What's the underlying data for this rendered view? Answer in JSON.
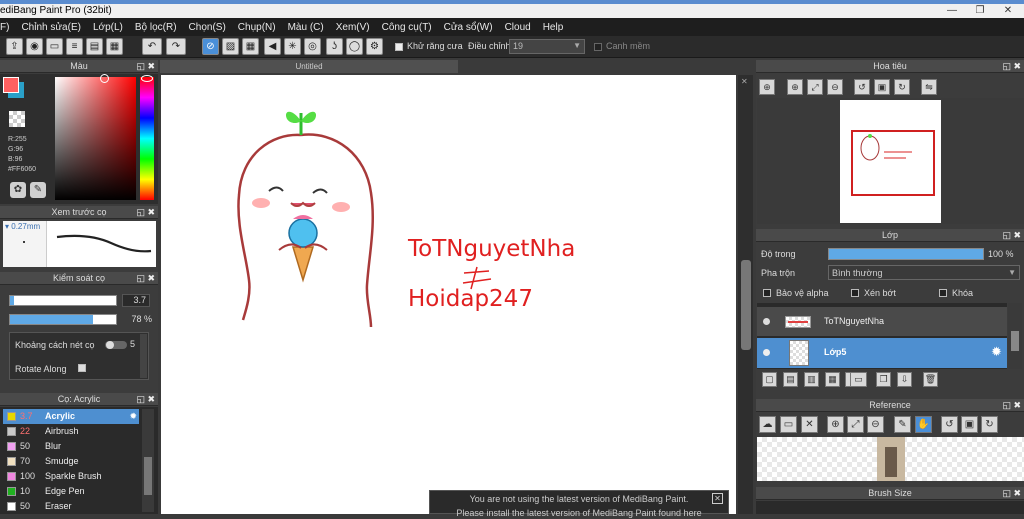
{
  "window": {
    "title": "ediBang Paint Pro (32bit)"
  },
  "menu": [
    "F)",
    "Chỉnh sửa(E)",
    "Lớp(L)",
    "Bộ lọc(R)",
    "Chọn(S)",
    "Chụp(N)",
    "Màu (C)",
    "Xem(V)",
    "Công cụ(T)",
    "Cửa sổ(W)",
    "Cloud",
    "Help"
  ],
  "toolbar": {
    "antialias_label": "Khử răng cưa",
    "adjust_label": "Điều chỉnh",
    "adjust_value": "19",
    "smooth_label": "Canh mềm"
  },
  "color_panel": {
    "title": "Màu",
    "r": "R:255",
    "g": "G:96",
    "b": "B:96",
    "hex": "#FF6060",
    "primary": "#ff6060",
    "secondary": "#2aa0c8"
  },
  "brush_preview": {
    "title": "Xem trước cọ",
    "size": "0.27mm"
  },
  "brush_control": {
    "title": "Kiểm soát cọ",
    "size": "3.7",
    "opacity": "78 %",
    "spacing_label": "Khoảng cách nét cọ",
    "spacing_value": "5",
    "rotate_label": "Rotate Along"
  },
  "brush_list": {
    "title": "Cọ: Acrylic",
    "items": [
      {
        "size": "3.7",
        "name": "Acrylic",
        "color": "#e8d800"
      },
      {
        "size": "22",
        "name": "Airbrush",
        "color": "#c8c8c8"
      },
      {
        "size": "50",
        "name": "Blur",
        "color": "#f0a0f0"
      },
      {
        "size": "70",
        "name": "Smudge",
        "color": "#f0e0c0"
      },
      {
        "size": "100",
        "name": "Sparkle Brush",
        "color": "#f088e0"
      },
      {
        "size": "10",
        "name": "Edge Pen",
        "color": "#20b020"
      },
      {
        "size": "50",
        "name": "Eraser",
        "color": "#ffffff"
      }
    ]
  },
  "canvas": {
    "tab": "Untitled",
    "text1": "ToTNguyetNha",
    "text2": "Hoidap247"
  },
  "notice": {
    "line1": "You are not using the latest version of MediBang Paint.",
    "line2": "Please install the latest version of MediBang Paint found here"
  },
  "navigator": {
    "title": "Hoa tiêu"
  },
  "layers": {
    "title": "Lớp",
    "opacity_label": "Độ trong",
    "opacity_value": "100 %",
    "opacity_fraction": 1.0,
    "blend_label": "Pha trộn",
    "blend_value": "Bình thường",
    "protect_alpha": "Bảo vệ alpha",
    "clipping": "Xén bớt",
    "lock": "Khóa",
    "items": [
      {
        "name": "ToTNguyetNha",
        "selected": false
      },
      {
        "name": "Lớp5",
        "selected": true
      }
    ]
  },
  "reference": {
    "title": "Reference"
  },
  "brush_size": {
    "title": "Brush Size"
  }
}
